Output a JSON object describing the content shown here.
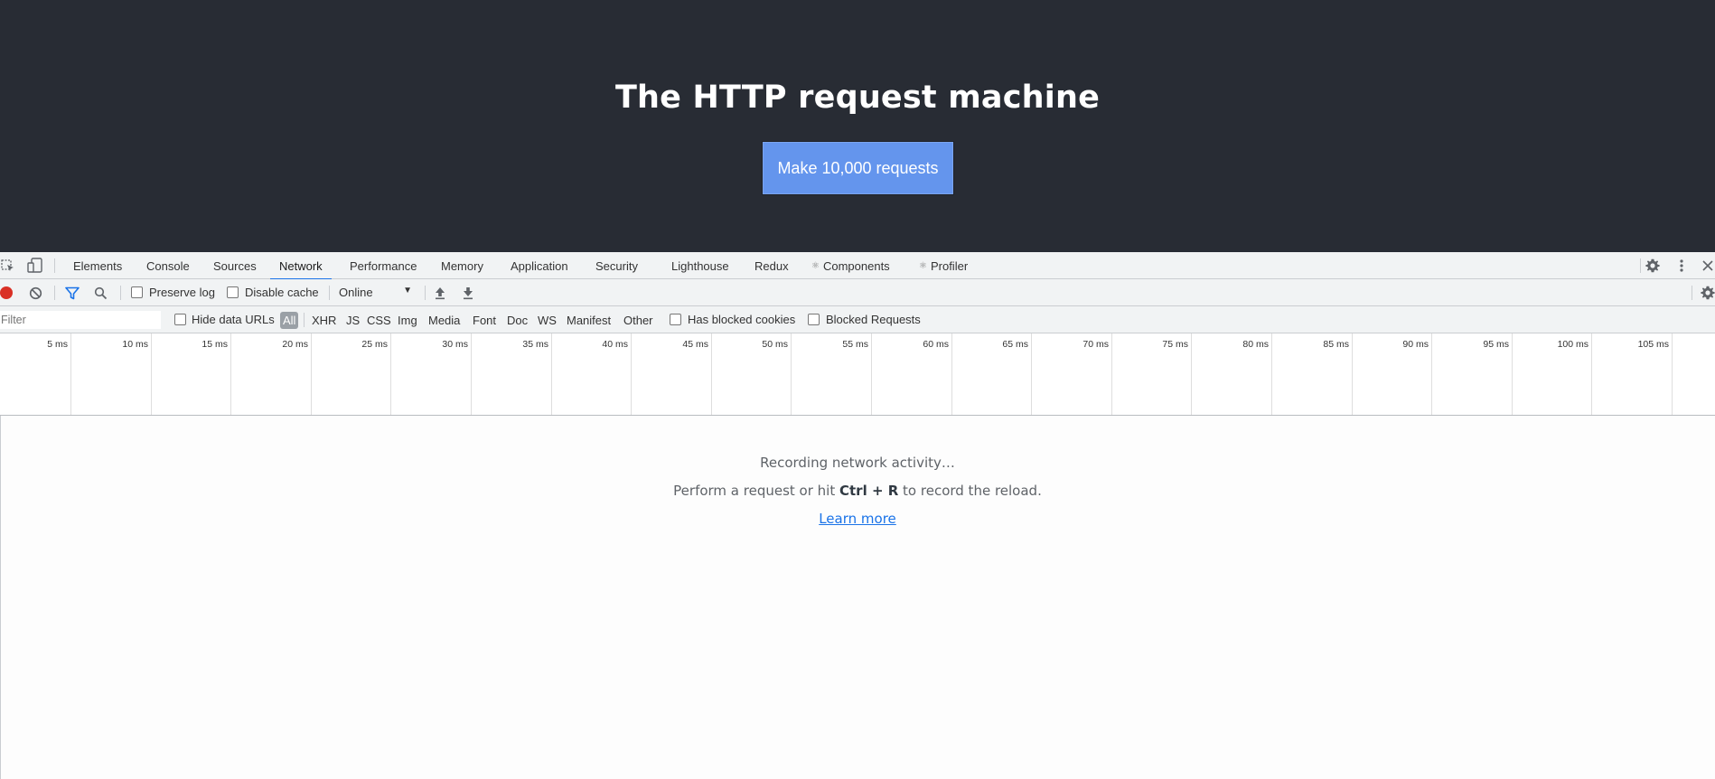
{
  "app": {
    "title": "The HTTP request machine",
    "button_label": "Make 10,000 requests",
    "background": "#282c34",
    "button_color": "#6495ed"
  },
  "devtools": {
    "tabs": [
      {
        "label": "Elements"
      },
      {
        "label": "Console"
      },
      {
        "label": "Sources"
      },
      {
        "label": "Network",
        "active": true
      },
      {
        "label": "Performance"
      },
      {
        "label": "Memory"
      },
      {
        "label": "Application"
      },
      {
        "label": "Security"
      },
      {
        "label": "Lighthouse"
      },
      {
        "label": "Redux"
      },
      {
        "label": "Components"
      },
      {
        "label": "Profiler"
      }
    ],
    "tab_icons": {
      "components": "react-icon",
      "profiler": "react-icon"
    },
    "toolbar": {
      "preserve_log": "Preserve log",
      "disable_cache": "Disable cache",
      "throttle_value": "Online"
    },
    "filter_bar": {
      "filter_placeholder": "Filter",
      "hide_data_urls": "Hide data URLs",
      "types": [
        "All",
        "XHR",
        "JS",
        "CSS",
        "Img",
        "Media",
        "Font",
        "Doc",
        "WS",
        "Manifest",
        "Other"
      ],
      "has_blocked_cookies": "Has blocked cookies",
      "blocked_requests": "Blocked Requests"
    },
    "timeline_ticks": [
      "5 ms",
      "10 ms",
      "15 ms",
      "20 ms",
      "25 ms",
      "30 ms",
      "35 ms",
      "40 ms",
      "45 ms",
      "50 ms",
      "55 ms",
      "60 ms",
      "65 ms",
      "70 ms",
      "75 ms",
      "80 ms",
      "85 ms",
      "90 ms",
      "95 ms",
      "100 ms",
      "105 ms"
    ],
    "empty_state": {
      "recording": "Recording network activity…",
      "hint_prefix": "Perform a request or hit ",
      "hint_shortcut": "Ctrl + R",
      "hint_suffix": " to record the reload.",
      "learn_more": "Learn more"
    },
    "accent_color": "#1a73e8",
    "record_color": "#d93025"
  }
}
